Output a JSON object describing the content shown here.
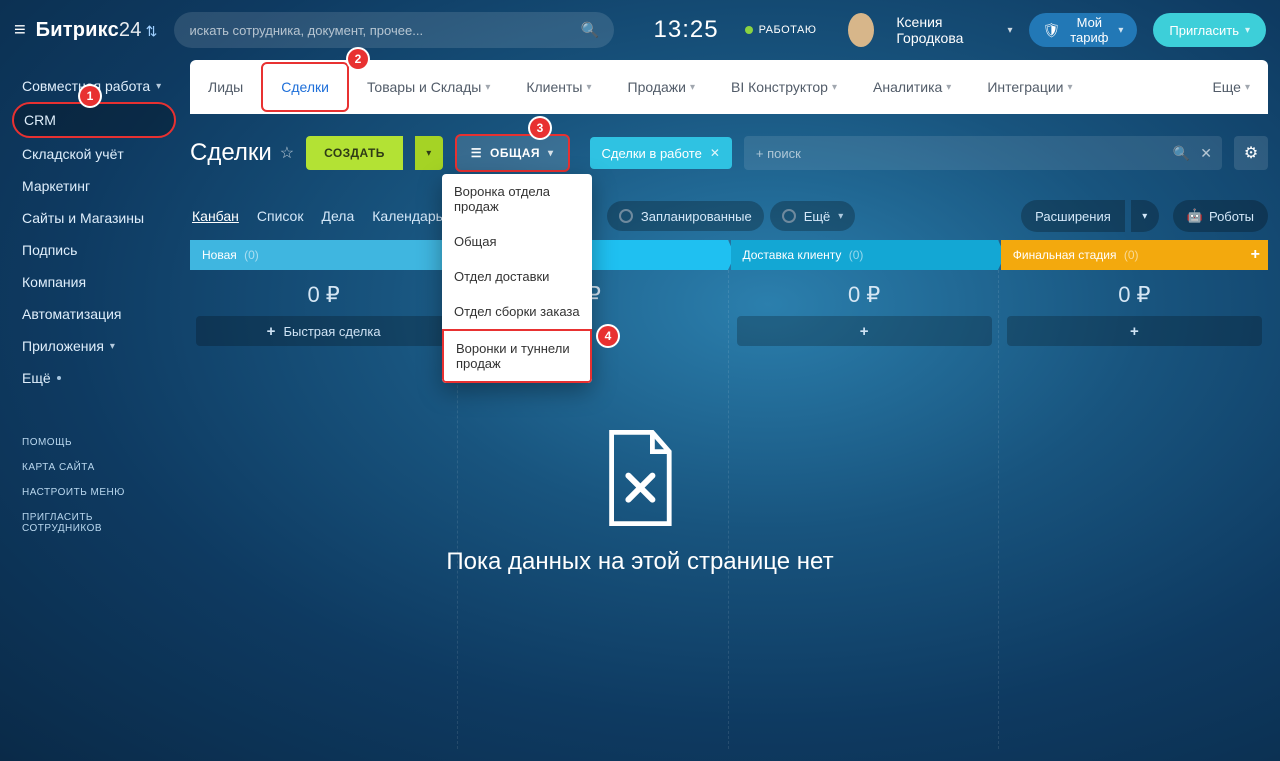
{
  "header": {
    "logo_main": "Битрикс",
    "logo_sub": "24",
    "search_placeholder": "искать сотрудника, документ, прочее...",
    "time": "13:25",
    "work_status": "РАБОТАЮ",
    "username": "Ксения Городкова",
    "tariff_label": "Мой тариф",
    "invite_label": "Пригласить"
  },
  "sidebar": {
    "items": [
      {
        "label": "Совместная работа",
        "has_chevron": true
      },
      {
        "label": "CRM",
        "active": true
      },
      {
        "label": "Складской учёт"
      },
      {
        "label": "Маркетинг"
      },
      {
        "label": "Сайты и Магазины"
      },
      {
        "label": "Подпись"
      },
      {
        "label": "Компания"
      },
      {
        "label": "Автоматизация"
      },
      {
        "label": "Приложения",
        "has_chevron": true
      },
      {
        "label": "Ещё",
        "has_dot": true
      }
    ],
    "bottom": [
      {
        "label": "ПОМОЩЬ"
      },
      {
        "label": "КАРТА САЙТА"
      },
      {
        "label": "НАСТРОИТЬ МЕНЮ"
      },
      {
        "label": "ПРИГЛАСИТЬ СОТРУДНИКОВ"
      }
    ]
  },
  "main_tabs": [
    {
      "label": "Лиды"
    },
    {
      "label": "Сделки",
      "active": true
    },
    {
      "label": "Товары и Склады",
      "chev": true
    },
    {
      "label": "Клиенты",
      "chev": true
    },
    {
      "label": "Продажи",
      "chev": true
    },
    {
      "label": "BI Конструктор",
      "chev": true
    },
    {
      "label": "Аналитика",
      "chev": true
    },
    {
      "label": "Интеграции",
      "chev": true
    }
  ],
  "main_tabs_more": "Еще",
  "page": {
    "title": "Сделки",
    "create": "СОЗДАТЬ",
    "funnel": "ОБЩАЯ",
    "tag": "Сделки в работе",
    "search_placeholder": "+ поиск"
  },
  "view_tabs": [
    {
      "label": "Канбан",
      "active": true
    },
    {
      "label": "Список"
    },
    {
      "label": "Дела"
    },
    {
      "label": "Календарь"
    }
  ],
  "view_pills": {
    "planned": "Запланированные",
    "more": "Ещё"
  },
  "view_right": {
    "extensions": "Расширения",
    "robots": "Роботы"
  },
  "kanban": {
    "columns": [
      {
        "name": "Новая",
        "count": "(0)",
        "sum": "0 ₽"
      },
      {
        "name": "",
        "count": "",
        "sum": "₽"
      },
      {
        "name": "Доставка клиенту",
        "count": "(0)",
        "sum": "0 ₽"
      },
      {
        "name": "Финальная стадия",
        "count": "(0)",
        "sum": "0 ₽"
      }
    ],
    "quick_deal": "Быстрая сделка",
    "add_plus": "+"
  },
  "empty_state": "Пока данных на этой странице нет",
  "popover": {
    "items": [
      "Воронка отдела продаж",
      "Общая",
      "Отдел доставки",
      "Отдел сборки заказа",
      "Воронки и туннели продаж"
    ]
  },
  "annotations": {
    "a1": "1",
    "a2": "2",
    "a3": "3",
    "a4": "4"
  }
}
